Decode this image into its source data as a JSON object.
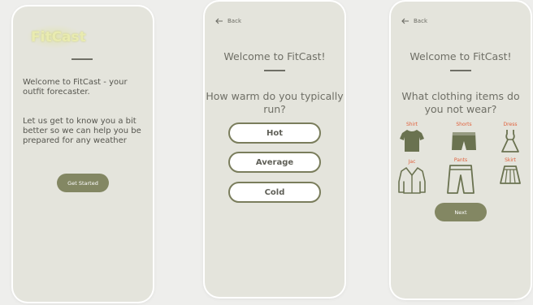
{
  "screens": [
    {
      "logo": "FitCast",
      "intro": "Welcome to FitCast - your outfit forecaster.",
      "body": "Let us get to know you a bit better so we can help you be prepared for any weather",
      "cta": "Get Started"
    },
    {
      "back": "Back",
      "title": "Welcome to FitCast!",
      "question": "How warm do you typically run?",
      "options": [
        "Hot",
        "Average",
        "Cold"
      ]
    },
    {
      "back": "Back",
      "title": "Welcome to FitCast!",
      "question": "What clothing items do you not wear?",
      "items": [
        {
          "label": "Shirt",
          "icon": "shirt-icon"
        },
        {
          "label": "Shorts",
          "icon": "shorts-icon"
        },
        {
          "label": "Dress",
          "icon": "dress-icon"
        },
        {
          "label": "Jac",
          "icon": "jacket-icon"
        },
        {
          "label": "Pants",
          "icon": "pants-icon"
        },
        {
          "label": "Skirt",
          "icon": "skirt-icon"
        }
      ],
      "next": "Next"
    }
  ],
  "colors": {
    "screen_bg": "#e4e4dc",
    "button": "#838763",
    "accent_label": "#e0603c",
    "icon": "#6a7250"
  }
}
